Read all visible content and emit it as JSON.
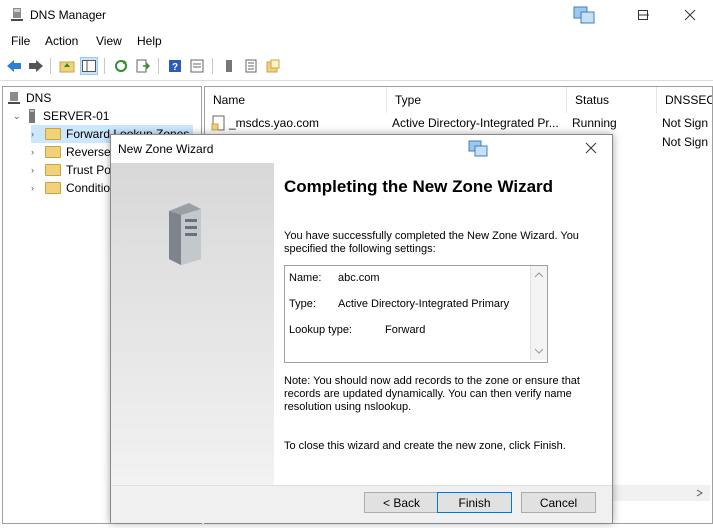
{
  "window": {
    "title": "DNS Manager"
  },
  "menu": [
    "File",
    "Action",
    "View",
    "Help"
  ],
  "tree": {
    "root": "DNS",
    "server": "SERVER-01",
    "children": [
      "Forward Lookup Zones",
      "Reverse Lookup Zones",
      "Trust Points",
      "Conditional Forwarders"
    ]
  },
  "list": {
    "columns": [
      "Name",
      "Type",
      "Status",
      "DNSSEC"
    ],
    "rows": [
      {
        "name": "_msdcs.yao.com",
        "type": "Active Directory-Integrated Pr...",
        "status": "Running",
        "dnssec": "Not Sign"
      },
      {
        "name": "",
        "type": "",
        "status": "ng",
        "dnssec": "Not Sign"
      }
    ]
  },
  "wizard": {
    "title": "New Zone Wizard",
    "heading": "Completing the New Zone Wizard",
    "intro": "You have successfully completed the New Zone Wizard. You specified the following settings:",
    "settings": [
      {
        "label": "Name:",
        "value": "abc.com"
      },
      {
        "label": "Type:",
        "value": "Active Directory-Integrated Primary"
      },
      {
        "label": "Lookup type:",
        "value": "Forward"
      }
    ],
    "note": "Note: You should now add records to the zone or ensure that records are updated dynamically. You can then verify name resolution using nslookup.",
    "finish_hint": "To close this wizard and create the new zone, click Finish.",
    "buttons": {
      "back": "< Back",
      "finish": "Finish",
      "cancel": "Cancel"
    }
  }
}
